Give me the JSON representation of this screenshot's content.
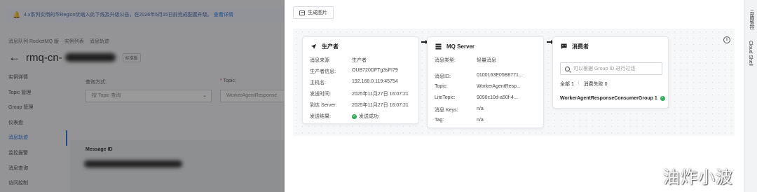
{
  "background": {
    "notice": {
      "text": "4.x系列实例的华Region优缩入此下线及升级公告，在2026年5月15日前完成配置升级。",
      "link": "查看详情"
    },
    "breadcrumb": [
      "消息队列 RocketMQ 版",
      "实例列表",
      "消息轨迹"
    ],
    "instance_title": "rmq-cn-",
    "instance_tag": "标准版",
    "nav": [
      "实例详情",
      "Topic 管理",
      "Group 管理",
      "仪表盘",
      "消息轨迹",
      "监控报警",
      "消息查询",
      "访问控制"
    ],
    "nav_active_index": 4,
    "query_method_label": "查询方式:",
    "query_method_value": "按 Topic 查询",
    "topic_label": "Topic:",
    "topic_value": "WorkerAgentResponse",
    "table_header": "Message ID"
  },
  "drawer": {
    "tab_label": "生成图片",
    "producer": {
      "title": "生产者",
      "rows": [
        {
          "k": "消息来源",
          "v": "生产者"
        },
        {
          "k": "生产者信息:",
          "v": "OUB720DFTg3sFI79"
        },
        {
          "k": "主机名:",
          "v": "192.168.0.119:45754"
        },
        {
          "k": "发送时间:",
          "v": "2025年11月27日 16:07:21"
        },
        {
          "k": "到达 Server:",
          "v": "2025年11月27日 16:07:21"
        },
        {
          "k": "发送结果:",
          "v": "发送成功"
        }
      ]
    },
    "server": {
      "title": "MQ Server",
      "rows": [
        {
          "k": "消息类型:",
          "v": "轻量消息"
        },
        {
          "k": "消息ID:",
          "v": "0100163E05B8771..."
        },
        {
          "k": "Topic:",
          "v": "WorkerAgentResp..."
        },
        {
          "k": "LiteTopic:",
          "v": "9090c10d-a50f-4..."
        },
        {
          "k": "消息 Keys:",
          "v": "n/a"
        },
        {
          "k": "Tag:",
          "v": "n/a"
        }
      ]
    },
    "consumer": {
      "title": "消费者",
      "search_placeholder": "可以根据 Group ID 进行过滤",
      "summary_all": "全部 1",
      "summary_failed": "消费失败 0",
      "group": "WorkerAgentResponseConsumerGroup 1"
    }
  },
  "rail": {
    "top": "云盾智控",
    "bottom": "Cloud Shell"
  },
  "watermark": "油炸小波",
  "colors": {
    "accent": "#1f6fe5",
    "success": "#2fae58",
    "canvas_bg": "#f6f7f9"
  }
}
